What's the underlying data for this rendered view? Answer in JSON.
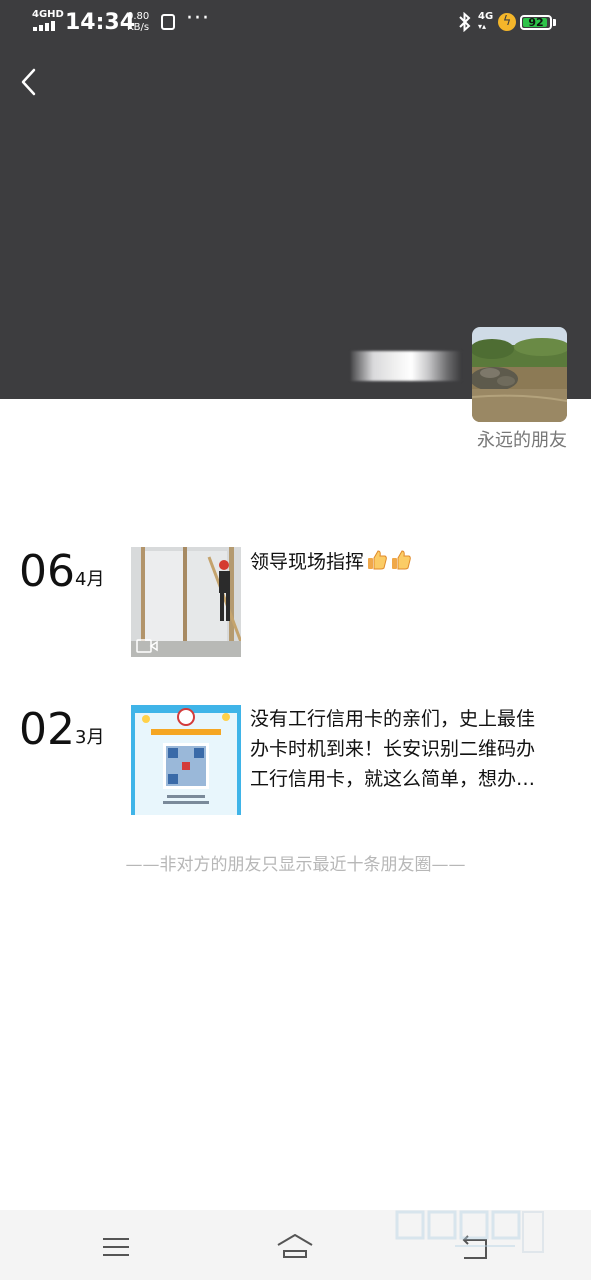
{
  "status_bar": {
    "network": "4GHD",
    "time": "14:34",
    "speed": "0.80",
    "speed_unit": "KB/s",
    "notif_glyph": "☐",
    "more": "···",
    "net2": "4G",
    "battery": "92",
    "battery_fraction": 0.92,
    "icons": [
      "signal-icon",
      "notification-icon",
      "bluetooth-icon",
      "charging-icon",
      "battery-icon"
    ]
  },
  "header": {
    "back_icon": "back-icon"
  },
  "profile": {
    "signature": "永远的朋友"
  },
  "posts": [
    {
      "day": "06",
      "month": "4月",
      "text": "领导现场指挥",
      "emoji": "thumbs-up-icon",
      "has_video": true
    },
    {
      "day": "02",
      "month": "3月",
      "text_lines": [
        "没有工行信用卡的亲们，史上最佳",
        "办卡时机到来！长安识别二维码办",
        "工行信用卡，就这么简单，想办…"
      ]
    }
  ],
  "footer_note": "——非对方的朋友只显示最近十条朋友圈——",
  "nav_bar": {
    "icons": [
      "menu-icon",
      "home-icon",
      "back-nav-icon"
    ]
  },
  "colors": {
    "cover": "#3d3d3f",
    "accent_green": "#2ec34a",
    "muted_text": "#b7b7b7"
  }
}
